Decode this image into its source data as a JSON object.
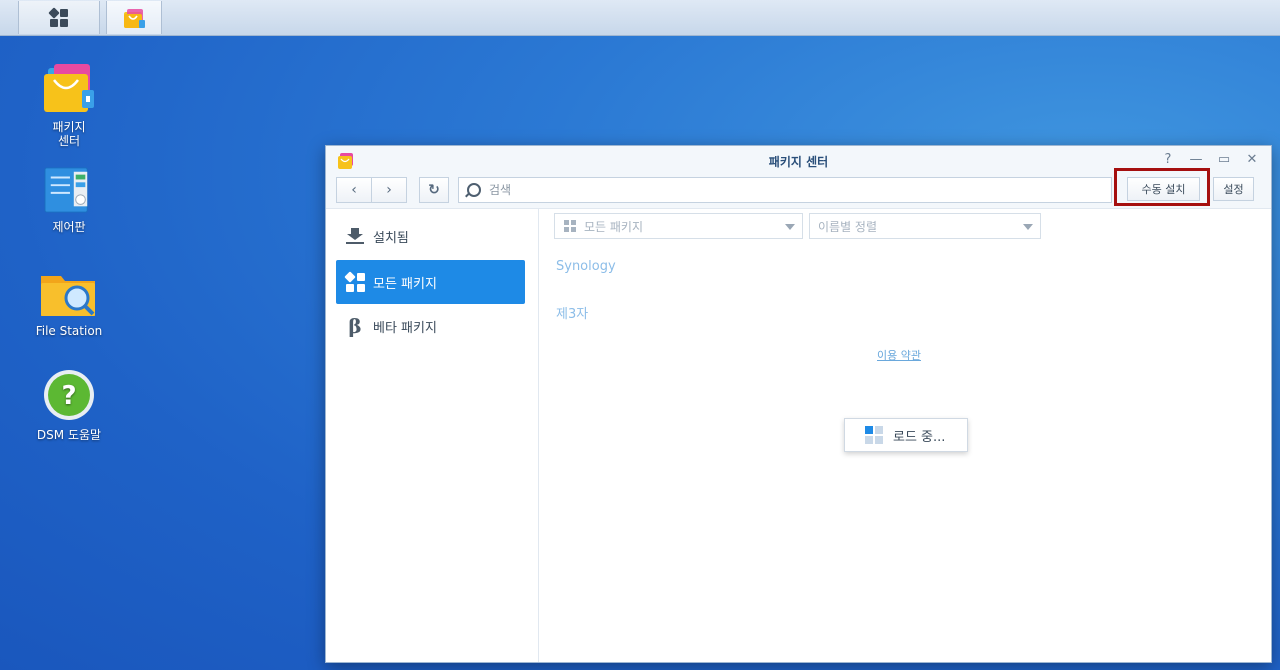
{
  "taskbar": {
    "main_menu_icon": "grid-icon",
    "pinned_app_icon": "package-center-icon"
  },
  "desktop": {
    "icons": [
      {
        "label": "패키지\n센터",
        "icon": "package-center-icon"
      },
      {
        "label": "제어판",
        "icon": "control-panel-icon"
      },
      {
        "label": "File Station",
        "icon": "folder-search-icon"
      },
      {
        "label": "DSM 도움말",
        "icon": "help-icon"
      }
    ]
  },
  "window": {
    "title": "패키지 센터",
    "controls": {
      "help": "?",
      "minimize": "—",
      "maximize": "▭",
      "close": "✕"
    },
    "toolbar": {
      "back": "‹",
      "forward": "›",
      "refresh": "↻",
      "search_placeholder": "검색",
      "manual_install": "수동 설치",
      "settings": "설정"
    },
    "sidebar": {
      "items": [
        {
          "label": "설치됨",
          "active": false
        },
        {
          "label": "모든 패키지",
          "active": true
        },
        {
          "label": "베타 패키지",
          "active": false
        }
      ]
    },
    "content": {
      "filter_dropdown": "모든 패키지",
      "sort_dropdown": "이름별 정렬",
      "sections": [
        "Synology",
        "제3자"
      ],
      "terms_link": "이용 약관",
      "loading_text": "로드 중..."
    }
  },
  "colors": {
    "accent": "#1e8ae6",
    "highlight_border": "#a50f0f",
    "desktop_bg": "#2b79d4"
  }
}
